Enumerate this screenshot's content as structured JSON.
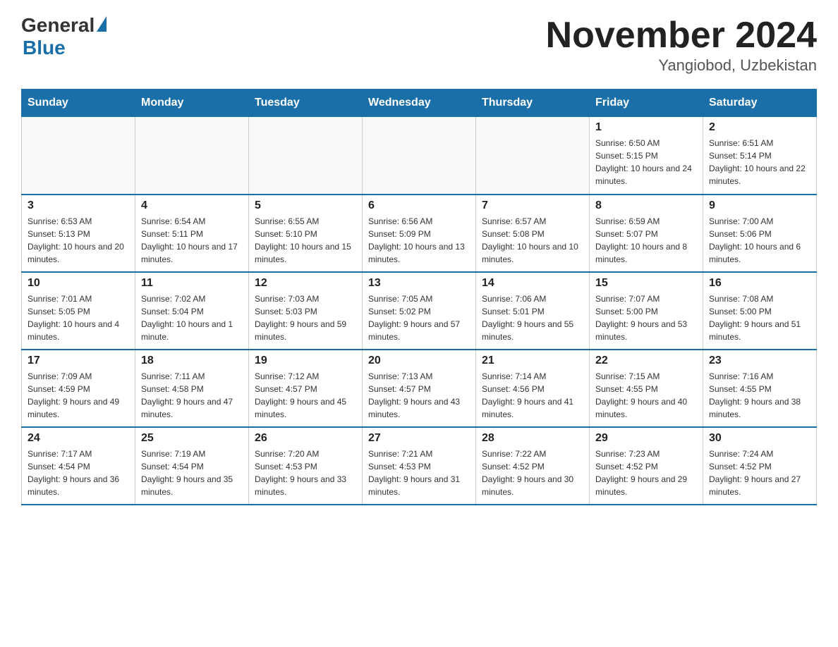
{
  "logo": {
    "general": "General",
    "blue": "Blue"
  },
  "title": "November 2024",
  "location": "Yangiobod, Uzbekistan",
  "weekdays": [
    "Sunday",
    "Monday",
    "Tuesday",
    "Wednesday",
    "Thursday",
    "Friday",
    "Saturday"
  ],
  "weeks": [
    [
      {
        "day": "",
        "info": ""
      },
      {
        "day": "",
        "info": ""
      },
      {
        "day": "",
        "info": ""
      },
      {
        "day": "",
        "info": ""
      },
      {
        "day": "",
        "info": ""
      },
      {
        "day": "1",
        "info": "Sunrise: 6:50 AM\nSunset: 5:15 PM\nDaylight: 10 hours and 24 minutes."
      },
      {
        "day": "2",
        "info": "Sunrise: 6:51 AM\nSunset: 5:14 PM\nDaylight: 10 hours and 22 minutes."
      }
    ],
    [
      {
        "day": "3",
        "info": "Sunrise: 6:53 AM\nSunset: 5:13 PM\nDaylight: 10 hours and 20 minutes."
      },
      {
        "day": "4",
        "info": "Sunrise: 6:54 AM\nSunset: 5:11 PM\nDaylight: 10 hours and 17 minutes."
      },
      {
        "day": "5",
        "info": "Sunrise: 6:55 AM\nSunset: 5:10 PM\nDaylight: 10 hours and 15 minutes."
      },
      {
        "day": "6",
        "info": "Sunrise: 6:56 AM\nSunset: 5:09 PM\nDaylight: 10 hours and 13 minutes."
      },
      {
        "day": "7",
        "info": "Sunrise: 6:57 AM\nSunset: 5:08 PM\nDaylight: 10 hours and 10 minutes."
      },
      {
        "day": "8",
        "info": "Sunrise: 6:59 AM\nSunset: 5:07 PM\nDaylight: 10 hours and 8 minutes."
      },
      {
        "day": "9",
        "info": "Sunrise: 7:00 AM\nSunset: 5:06 PM\nDaylight: 10 hours and 6 minutes."
      }
    ],
    [
      {
        "day": "10",
        "info": "Sunrise: 7:01 AM\nSunset: 5:05 PM\nDaylight: 10 hours and 4 minutes."
      },
      {
        "day": "11",
        "info": "Sunrise: 7:02 AM\nSunset: 5:04 PM\nDaylight: 10 hours and 1 minute."
      },
      {
        "day": "12",
        "info": "Sunrise: 7:03 AM\nSunset: 5:03 PM\nDaylight: 9 hours and 59 minutes."
      },
      {
        "day": "13",
        "info": "Sunrise: 7:05 AM\nSunset: 5:02 PM\nDaylight: 9 hours and 57 minutes."
      },
      {
        "day": "14",
        "info": "Sunrise: 7:06 AM\nSunset: 5:01 PM\nDaylight: 9 hours and 55 minutes."
      },
      {
        "day": "15",
        "info": "Sunrise: 7:07 AM\nSunset: 5:00 PM\nDaylight: 9 hours and 53 minutes."
      },
      {
        "day": "16",
        "info": "Sunrise: 7:08 AM\nSunset: 5:00 PM\nDaylight: 9 hours and 51 minutes."
      }
    ],
    [
      {
        "day": "17",
        "info": "Sunrise: 7:09 AM\nSunset: 4:59 PM\nDaylight: 9 hours and 49 minutes."
      },
      {
        "day": "18",
        "info": "Sunrise: 7:11 AM\nSunset: 4:58 PM\nDaylight: 9 hours and 47 minutes."
      },
      {
        "day": "19",
        "info": "Sunrise: 7:12 AM\nSunset: 4:57 PM\nDaylight: 9 hours and 45 minutes."
      },
      {
        "day": "20",
        "info": "Sunrise: 7:13 AM\nSunset: 4:57 PM\nDaylight: 9 hours and 43 minutes."
      },
      {
        "day": "21",
        "info": "Sunrise: 7:14 AM\nSunset: 4:56 PM\nDaylight: 9 hours and 41 minutes."
      },
      {
        "day": "22",
        "info": "Sunrise: 7:15 AM\nSunset: 4:55 PM\nDaylight: 9 hours and 40 minutes."
      },
      {
        "day": "23",
        "info": "Sunrise: 7:16 AM\nSunset: 4:55 PM\nDaylight: 9 hours and 38 minutes."
      }
    ],
    [
      {
        "day": "24",
        "info": "Sunrise: 7:17 AM\nSunset: 4:54 PM\nDaylight: 9 hours and 36 minutes."
      },
      {
        "day": "25",
        "info": "Sunrise: 7:19 AM\nSunset: 4:54 PM\nDaylight: 9 hours and 35 minutes."
      },
      {
        "day": "26",
        "info": "Sunrise: 7:20 AM\nSunset: 4:53 PM\nDaylight: 9 hours and 33 minutes."
      },
      {
        "day": "27",
        "info": "Sunrise: 7:21 AM\nSunset: 4:53 PM\nDaylight: 9 hours and 31 minutes."
      },
      {
        "day": "28",
        "info": "Sunrise: 7:22 AM\nSunset: 4:52 PM\nDaylight: 9 hours and 30 minutes."
      },
      {
        "day": "29",
        "info": "Sunrise: 7:23 AM\nSunset: 4:52 PM\nDaylight: 9 hours and 29 minutes."
      },
      {
        "day": "30",
        "info": "Sunrise: 7:24 AM\nSunset: 4:52 PM\nDaylight: 9 hours and 27 minutes."
      }
    ]
  ]
}
